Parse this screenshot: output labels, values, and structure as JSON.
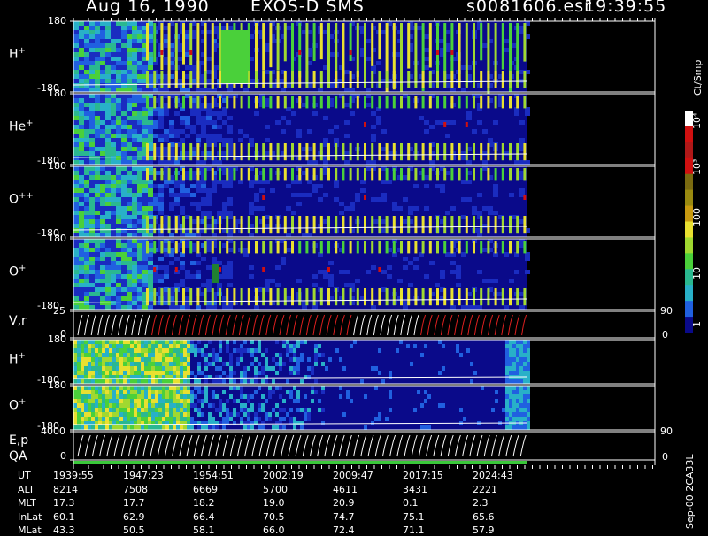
{
  "header": {
    "date": "Aug 16, 1990",
    "instrument": "EXOS-D SMS",
    "file": "s0081606.esr",
    "time": "19:39:55"
  },
  "panels": [
    {
      "label": "H",
      "sup": "+",
      "ytop": "180",
      "ybot": "-180"
    },
    {
      "label": "He",
      "sup": "+",
      "ytop": "180",
      "ybot": "-180"
    },
    {
      "label": "O",
      "sup": "++",
      "ytop": "180",
      "ybot": "-180"
    },
    {
      "label": "O",
      "sup": "+",
      "ytop": "180",
      "ybot": "-180"
    },
    {
      "label": "V,r",
      "sup": "",
      "ytop": "25",
      "ybot": "0",
      "rtop": "90",
      "rbot": "0"
    },
    {
      "label": "H",
      "sup": "+",
      "ytop": "180",
      "ybot": "-180"
    },
    {
      "label": "O",
      "sup": "+",
      "ytop": "180",
      "ybot": "-180"
    },
    {
      "label": "E,p",
      "sup": "",
      "ytop": "4000",
      "ybot": "0",
      "rtop": "90",
      "rbot": "0"
    }
  ],
  "qa_label": "QA",
  "colorbar": {
    "unit": "Ct/Smp",
    "labels": [
      "10⁴",
      "10³",
      "100",
      "10",
      "1"
    ]
  },
  "side_note": "Sep-00 2CA33L",
  "footer": {
    "rows": [
      {
        "name": "UT",
        "values": [
          "1939:55",
          "1947:23",
          "1954:51",
          "2002:19",
          "2009:47",
          "2017:15",
          "2024:43"
        ]
      },
      {
        "name": "ALT",
        "values": [
          "8214",
          "7508",
          "6669",
          "5700",
          "4611",
          "3431",
          "2221"
        ]
      },
      {
        "name": "MLT",
        "values": [
          "17.3",
          "17.7",
          "18.2",
          "19.0",
          "20.9",
          "0.1",
          "2.3"
        ]
      },
      {
        "name": "InLat",
        "values": [
          "60.1",
          "62.9",
          "66.4",
          "70.5",
          "74.7",
          "75.1",
          "65.6"
        ]
      },
      {
        "name": "MLat",
        "values": [
          "43.3",
          "50.5",
          "58.1",
          "66.0",
          "72.4",
          "71.1",
          "57.9"
        ]
      }
    ]
  },
  "chart_data": {
    "type": "heatmap",
    "title": "Aug 16, 1990 EXOS-D SMS",
    "x": [
      "1939:55",
      "1947:23",
      "1954:51",
      "2002:19",
      "2009:47",
      "2017:15",
      "2024:43"
    ],
    "colors": {
      "low": "#0a0a8a",
      "mid": "#28b0c8",
      "green": "#4ad03a",
      "yellow": "#e8e030",
      "olive": "#7a6a10",
      "red": "#d01010",
      "white": "#ffffff"
    },
    "series": [
      {
        "name": "H+",
        "yrange": [
          -180,
          180
        ]
      },
      {
        "name": "He+",
        "yrange": [
          -180,
          180
        ]
      },
      {
        "name": "O++",
        "yrange": [
          -180,
          180
        ]
      },
      {
        "name": "O+",
        "yrange": [
          -180,
          180
        ]
      },
      {
        "name": "V,r",
        "yrange": [
          0,
          25
        ]
      },
      {
        "name": "H+",
        "yrange": [
          -180,
          180
        ]
      },
      {
        "name": "O+",
        "yrange": [
          -180,
          180
        ]
      },
      {
        "name": "E,p",
        "yrange": [
          0,
          4000
        ]
      }
    ]
  }
}
